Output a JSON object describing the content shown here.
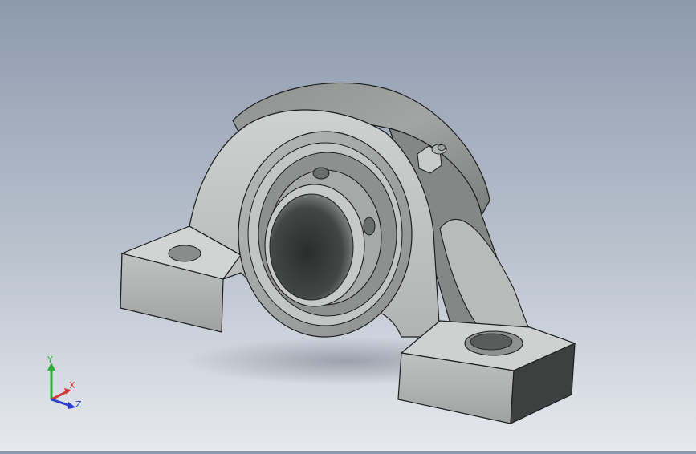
{
  "viewport": {
    "model": "pillow-block-bearing",
    "background_top": "#8d9aae",
    "background_bottom": "#e6e9ee"
  },
  "triad": {
    "x_label": "X",
    "y_label": "Y",
    "z_label": "Z",
    "x_color": "#d23a3a",
    "y_color": "#2fae35",
    "z_color": "#2a3fd0"
  },
  "colors": {
    "housing_light": "#c4c6c5",
    "housing_mid": "#a9abaa",
    "housing_dark": "#6d6f6e",
    "insert_ring": "#9a9c9b",
    "bore_dark": "#3a3c3b"
  }
}
